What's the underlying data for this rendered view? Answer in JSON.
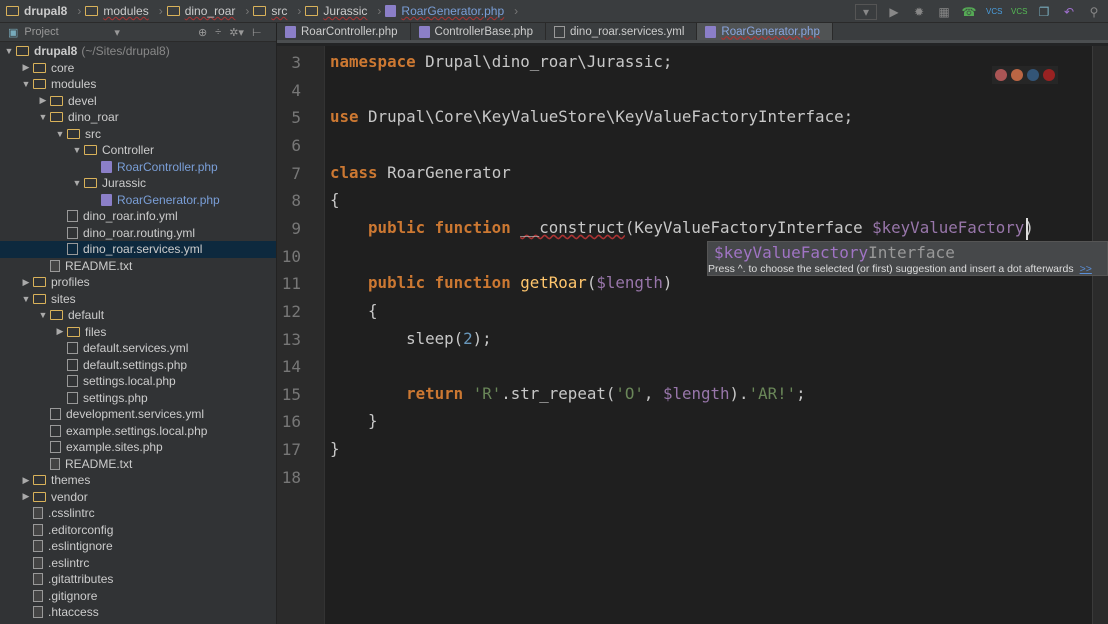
{
  "breadcrumbs": [
    {
      "label": "drupal8",
      "type": "folder"
    },
    {
      "label": "modules",
      "type": "folder"
    },
    {
      "label": "dino_roar",
      "type": "folder"
    },
    {
      "label": "src",
      "type": "folder"
    },
    {
      "label": "Jurassic",
      "type": "folder"
    },
    {
      "label": "RoarGenerator.php",
      "type": "php"
    }
  ],
  "toolbar": {
    "icons": [
      "run-config-dropdown-icon",
      "run-icon",
      "debug-icon",
      "coverage-icon",
      "php-debug-listen-icon",
      "vcs-update-icon",
      "vcs-commit-icon",
      "history-icon",
      "revert-icon",
      "search-icon"
    ],
    "vcs": "VCS"
  },
  "sidebar": {
    "title": "Project",
    "tree": [
      {
        "label": "drupal8",
        "hint": "(~/Sites/drupal8)",
        "depth": 0,
        "type": "folder",
        "open": true
      },
      {
        "label": "core",
        "depth": 1,
        "type": "folder",
        "open": false
      },
      {
        "label": "modules",
        "depth": 1,
        "type": "folder",
        "open": true
      },
      {
        "label": "devel",
        "depth": 2,
        "type": "folder",
        "open": false
      },
      {
        "label": "dino_roar",
        "depth": 2,
        "type": "folder",
        "open": true
      },
      {
        "label": "src",
        "depth": 3,
        "type": "folder",
        "open": true
      },
      {
        "label": "Controller",
        "depth": 4,
        "type": "folder",
        "open": true
      },
      {
        "label": "RoarController.php",
        "depth": 5,
        "type": "php"
      },
      {
        "label": "Jurassic",
        "depth": 4,
        "type": "folder",
        "open": true
      },
      {
        "label": "RoarGenerator.php",
        "depth": 5,
        "type": "php"
      },
      {
        "label": "dino_roar.info.yml",
        "depth": 3,
        "type": "yml"
      },
      {
        "label": "dino_roar.routing.yml",
        "depth": 3,
        "type": "yml"
      },
      {
        "label": "dino_roar.services.yml",
        "depth": 3,
        "type": "yml",
        "selected": true
      },
      {
        "label": "README.txt",
        "depth": 2,
        "type": "txt"
      },
      {
        "label": "profiles",
        "depth": 1,
        "type": "folder",
        "open": false
      },
      {
        "label": "sites",
        "depth": 1,
        "type": "folder",
        "open": true
      },
      {
        "label": "default",
        "depth": 2,
        "type": "folder",
        "open": true
      },
      {
        "label": "files",
        "depth": 3,
        "type": "folder",
        "open": false
      },
      {
        "label": "default.services.yml",
        "depth": 3,
        "type": "yml"
      },
      {
        "label": "default.settings.php",
        "depth": 3,
        "type": "yml"
      },
      {
        "label": "settings.local.php",
        "depth": 3,
        "type": "yml"
      },
      {
        "label": "settings.php",
        "depth": 3,
        "type": "yml"
      },
      {
        "label": "development.services.yml",
        "depth": 2,
        "type": "yml"
      },
      {
        "label": "example.settings.local.php",
        "depth": 2,
        "type": "yml"
      },
      {
        "label": "example.sites.php",
        "depth": 2,
        "type": "yml"
      },
      {
        "label": "README.txt",
        "depth": 2,
        "type": "txt"
      },
      {
        "label": "themes",
        "depth": 1,
        "type": "folder",
        "open": false
      },
      {
        "label": "vendor",
        "depth": 1,
        "type": "folder",
        "open": false
      },
      {
        "label": ".csslintrc",
        "depth": 1,
        "type": "txt"
      },
      {
        "label": ".editorconfig",
        "depth": 1,
        "type": "txt"
      },
      {
        "label": ".eslintignore",
        "depth": 1,
        "type": "txt"
      },
      {
        "label": ".eslintrc",
        "depth": 1,
        "type": "txt"
      },
      {
        "label": ".gitattributes",
        "depth": 1,
        "type": "txt"
      },
      {
        "label": ".gitignore",
        "depth": 1,
        "type": "txt"
      },
      {
        "label": ".htaccess",
        "depth": 1,
        "type": "txt"
      }
    ]
  },
  "tabs": [
    {
      "label": "RoarController.php",
      "type": "php"
    },
    {
      "label": "ControllerBase.php",
      "type": "php"
    },
    {
      "label": "dino_roar.services.yml",
      "type": "yml"
    },
    {
      "label": "RoarGenerator.php",
      "type": "php",
      "active": true
    }
  ],
  "editor": {
    "lines": [
      {
        "n": "3",
        "html": "<span class=\"kw\">namespace</span> Drupal\\dino_roar\\Jurassic;"
      },
      {
        "n": "4",
        "html": ""
      },
      {
        "n": "5",
        "html": "<span class=\"kw\">use</span> Drupal\\Core\\KeyValueStore\\KeyValueFactoryInterface;"
      },
      {
        "n": "6",
        "html": ""
      },
      {
        "n": "7",
        "html": "<span class=\"kw\">class</span> RoarGenerator"
      },
      {
        "n": "8",
        "html": "{"
      },
      {
        "n": "9",
        "html": "    <span class=\"kw\">public function</span> <span class=\"squig\">__construct</span>(KeyValueFactoryInterface <span class=\"var\">$keyValueFactory</span>)"
      },
      {
        "n": "10",
        "html": ""
      },
      {
        "n": "11",
        "html": "    <span class=\"kw\">public function</span> <span class=\"fn\">getRoar</span>(<span class=\"var\">$length</span>)"
      },
      {
        "n": "12",
        "html": "    {"
      },
      {
        "n": "13",
        "html": "        sleep(<span class=\"num\">2</span>);"
      },
      {
        "n": "14",
        "html": ""
      },
      {
        "n": "15",
        "html": "        <span class=\"kw\">return</span> <span class=\"str\">'R'</span>.str_repeat(<span class=\"str\">'O'</span>, <span class=\"var\">$length</span>).<span class=\"str\">'AR!'</span>;"
      },
      {
        "n": "16",
        "html": "    }"
      },
      {
        "n": "17",
        "html": "}"
      },
      {
        "n": "18",
        "html": ""
      }
    ]
  },
  "completion": {
    "match": "$keyValueFactory",
    "rest": "Interface",
    "hint": "Press ^. to choose the selected (or first) suggestion and insert a dot afterwards",
    "more": ">>"
  },
  "colors": {
    "keyword": "#cc7832",
    "variable": "#9876aa",
    "string": "#6a8759",
    "number": "#6897bb"
  }
}
